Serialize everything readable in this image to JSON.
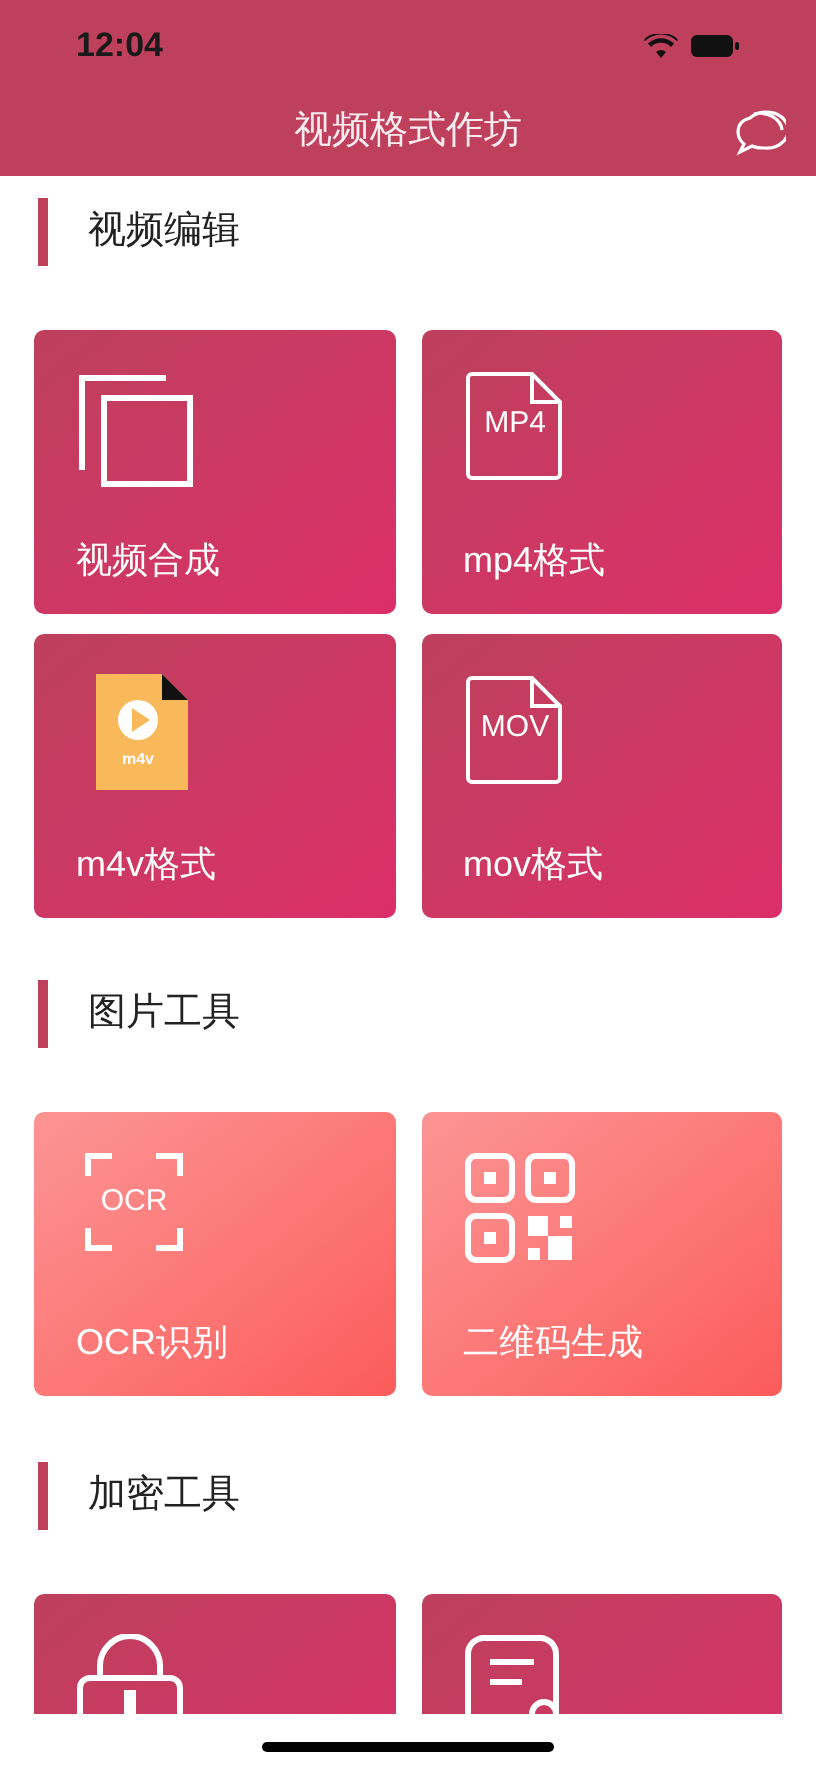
{
  "status_bar": {
    "time": "12:04"
  },
  "nav": {
    "title": "视频格式作坊"
  },
  "sections": [
    {
      "title": "视频编辑",
      "kind": "crimson",
      "cards": [
        {
          "kind": "copy",
          "label": "视频合成"
        },
        {
          "kind": "file",
          "icon_text": "MP4",
          "label": "mp4格式"
        },
        {
          "kind": "video",
          "icon_text": "m4v",
          "label": "m4v格式"
        },
        {
          "kind": "file",
          "icon_text": "MOV",
          "label": "mov格式"
        }
      ]
    },
    {
      "title": "图片工具",
      "kind": "coral",
      "cards": [
        {
          "kind": "scan",
          "icon_text": "OCR",
          "label": "OCR识别"
        },
        {
          "kind": "qr",
          "label": "二维码生成"
        }
      ]
    },
    {
      "title": "加密工具",
      "kind": "crimson",
      "cards": [
        {
          "kind": "lock"
        },
        {
          "kind": "document"
        }
      ]
    }
  ]
}
